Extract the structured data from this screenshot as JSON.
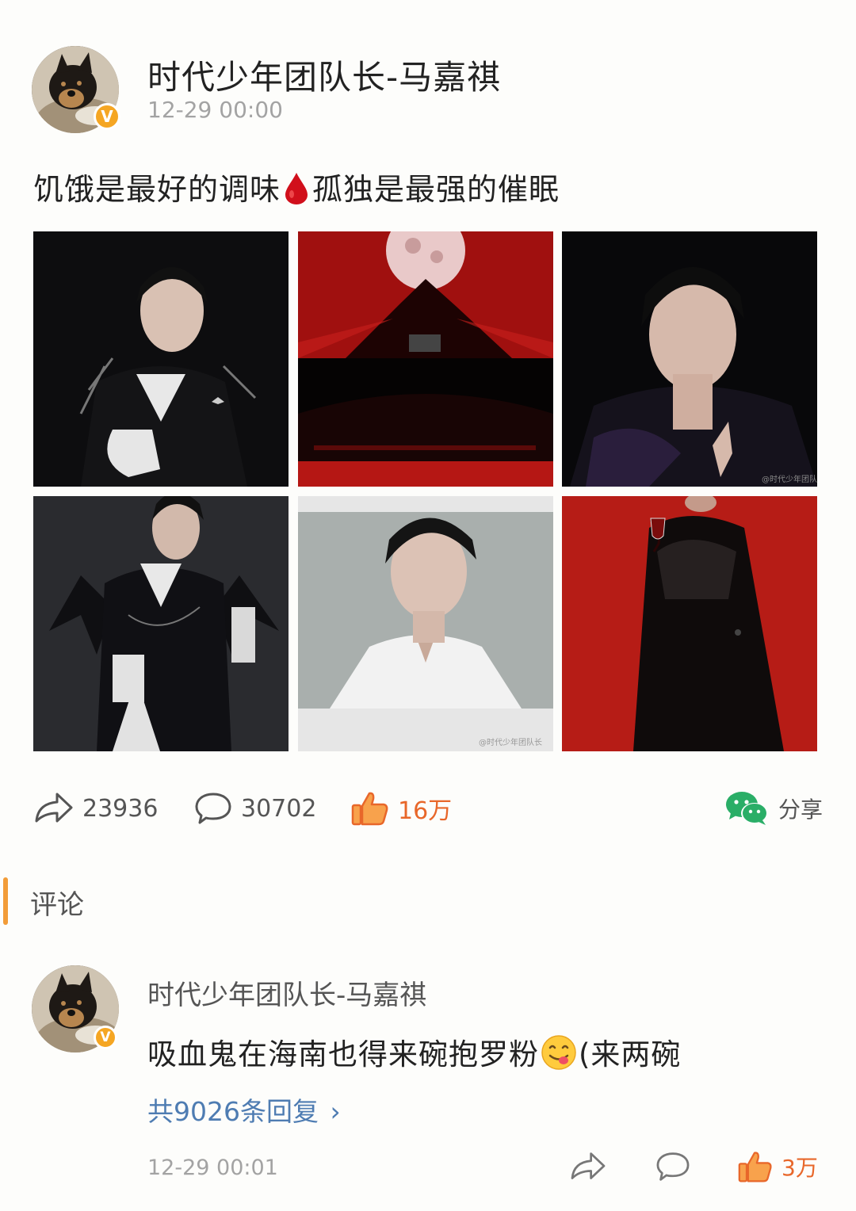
{
  "post": {
    "author": "时代少年团队长-马嘉祺",
    "verified_badge": "V",
    "time": "12-29 00:00",
    "text_before_emoji": "饥饿是最好的调味",
    "emoji": "blood-drop-icon",
    "text_after_emoji": "孤独是最强的催眠",
    "images": [
      {
        "name": "photo-black-cape-portrait"
      },
      {
        "name": "photo-red-moon-stage"
      },
      {
        "name": "photo-closeup-dark-portrait",
        "watermark": "@时代少年团队"
      },
      {
        "name": "photo-bat-wing-costume"
      },
      {
        "name": "photo-white-shirt-polaroid",
        "watermark": "@时代少年团队长"
      },
      {
        "name": "photo-red-background-wineglass"
      }
    ]
  },
  "actions": {
    "repost_count": "23936",
    "comment_count": "30702",
    "like_count": "16万",
    "share_label": "分享"
  },
  "comments_section": {
    "title": "评论",
    "accent_color": "#f29c38"
  },
  "comment": {
    "author": "时代少年团队长-马嘉祺",
    "verified_badge": "V",
    "text_before_emoji": "吸血鬼在海南也得来碗抱罗粉",
    "emoji": "yum-face-icon",
    "text_after_emoji": "(来两碗",
    "replies_label": "共9026条回复",
    "replies_chevron": "›",
    "time": "12-29 00:01",
    "like_count": "3万"
  },
  "colors": {
    "like_orange": "#e8672a",
    "link_blue": "#4e7cb2",
    "wechat_green": "#2aae67",
    "badge_orange": "#f5a623"
  }
}
